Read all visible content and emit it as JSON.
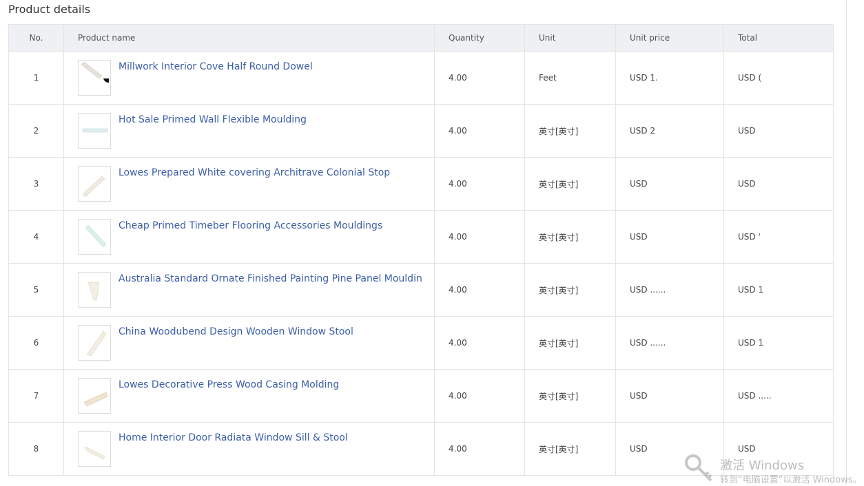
{
  "page_title": "Product details",
  "table": {
    "headers": [
      "No.",
      "Product name",
      "Quantity",
      "Unit",
      "Unit price",
      "Total"
    ],
    "rows": [
      {
        "no": "1",
        "name": "Millwork Interior Cove Half Round Dowel",
        "qty": "4.00",
        "unit": "Feet",
        "price": "USD 1.",
        "total": "USD ("
      },
      {
        "no": "2",
        "name": "Hot Sale Primed Wall Flexible Moulding",
        "qty": "4.00",
        "unit": "英寸[英寸]",
        "price": "USD 2",
        "total": "USD"
      },
      {
        "no": "3",
        "name": "Lowes Prepared White covering Architrave Colonial Stop",
        "qty": "4.00",
        "unit": "英寸[英寸]",
        "price": "USD",
        "total": "USD"
      },
      {
        "no": "4",
        "name": "Cheap Primed Timeber Flooring Accessories Mouldings",
        "qty": "4.00",
        "unit": "英寸[英寸]",
        "price": "USD",
        "total": "USD '"
      },
      {
        "no": "5",
        "name": "Australia Standard Ornate Finished Painting Pine Panel Moulding Pi",
        "qty": "4.00",
        "unit": "英寸[英寸]",
        "price": "USD ......",
        "total": "USD 1"
      },
      {
        "no": "6",
        "name": "China Woodubend Design Wooden Window Stool",
        "qty": "4.00",
        "unit": "英寸[英寸]",
        "price": "USD ......",
        "total": "USD 1"
      },
      {
        "no": "7",
        "name": "Lowes Decorative Press Wood Casing Molding",
        "qty": "4.00",
        "unit": "英寸[英寸]",
        "price": "USD",
        "total": "USD ....."
      },
      {
        "no": "8",
        "name": "Home Interior Door Radiata Window Sill & Stool",
        "qty": "4.00",
        "unit": "英寸[英寸]",
        "price": "USD",
        "total": "USD"
      }
    ]
  },
  "watermark": {
    "title": "激活 Windows",
    "subtitle": "转到“电脑设置”以激活 Windows。"
  },
  "icons": {
    "thumbnail": "product-thumbnail-icon",
    "watermark": "keys-icon"
  }
}
